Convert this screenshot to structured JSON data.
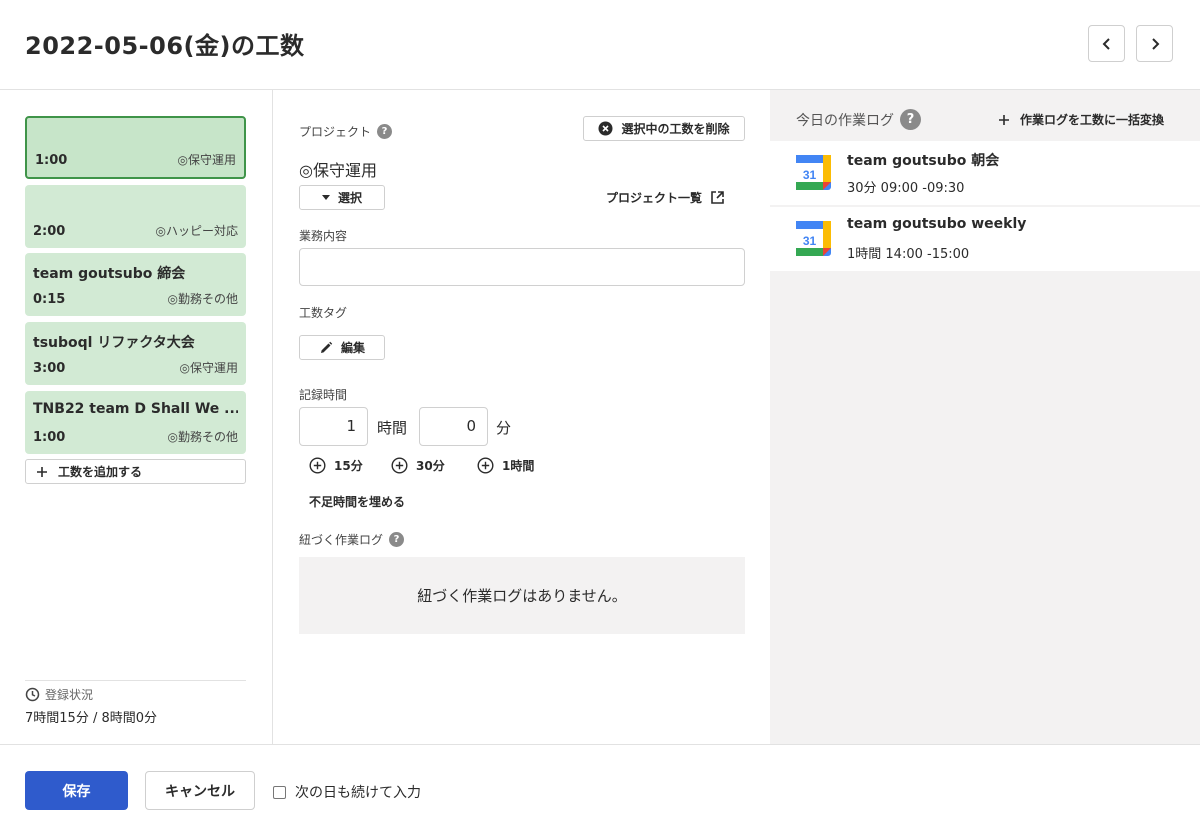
{
  "header": {
    "title": "2022-05-06(金)の工数"
  },
  "entries": [
    {
      "title": "",
      "time": "1:00",
      "project": "◎保守運用"
    },
    {
      "title": "",
      "time": "2:00",
      "project": "◎ハッピー対応"
    },
    {
      "title": "team goutsubo 締会",
      "time": "0:15",
      "project": "◎勤務その他"
    },
    {
      "title": "tsuboql リファクタ大会",
      "time": "3:00",
      "project": "◎保守運用"
    },
    {
      "title": "TNB22 team D Shall We ...",
      "time": "1:00",
      "project": "◎勤務その他"
    }
  ],
  "left": {
    "add_label": "工数を追加する",
    "status_label": "登録状況",
    "status_value": "7時間15分 / 8時間0分"
  },
  "form": {
    "project_label": "プロジェクト",
    "delete_label": "選択中の工数を削除",
    "project_value": "◎保守運用",
    "select_label": "選択",
    "project_list_label": "プロジェクト一覧",
    "task_label": "業務内容",
    "task_value": "",
    "tag_label": "工数タグ",
    "edit_label": "編集",
    "time_label": "記録時間",
    "hours_value": "1",
    "hours_unit": "時間",
    "minutes_value": "0",
    "minutes_unit": "分",
    "quick_15": "15分",
    "quick_30": "30分",
    "quick_60": "1時間",
    "fill_label": "不足時間を埋める",
    "linked_label": "紐づく作業ログ",
    "linked_empty": "紐づく作業ログはありません。"
  },
  "worklog": {
    "title": "今日の作業ログ",
    "bulk_label": "作業ログを工数に一括変換",
    "items": [
      {
        "title": "team goutsubo 朝会",
        "time": "30分  09:00 -09:30",
        "icon_day": "31"
      },
      {
        "title": "team goutsubo weekly",
        "time": "1時間  14:00 -15:00",
        "icon_day": "31"
      }
    ]
  },
  "footer": {
    "save_label": "保存",
    "cancel_label": "キャンセル",
    "continue_label": "次の日も続けて入力"
  },
  "colors": {
    "accent": "#2f5bcc",
    "card_bg": "#d2ead4",
    "card_selected_border": "#3f9449"
  }
}
